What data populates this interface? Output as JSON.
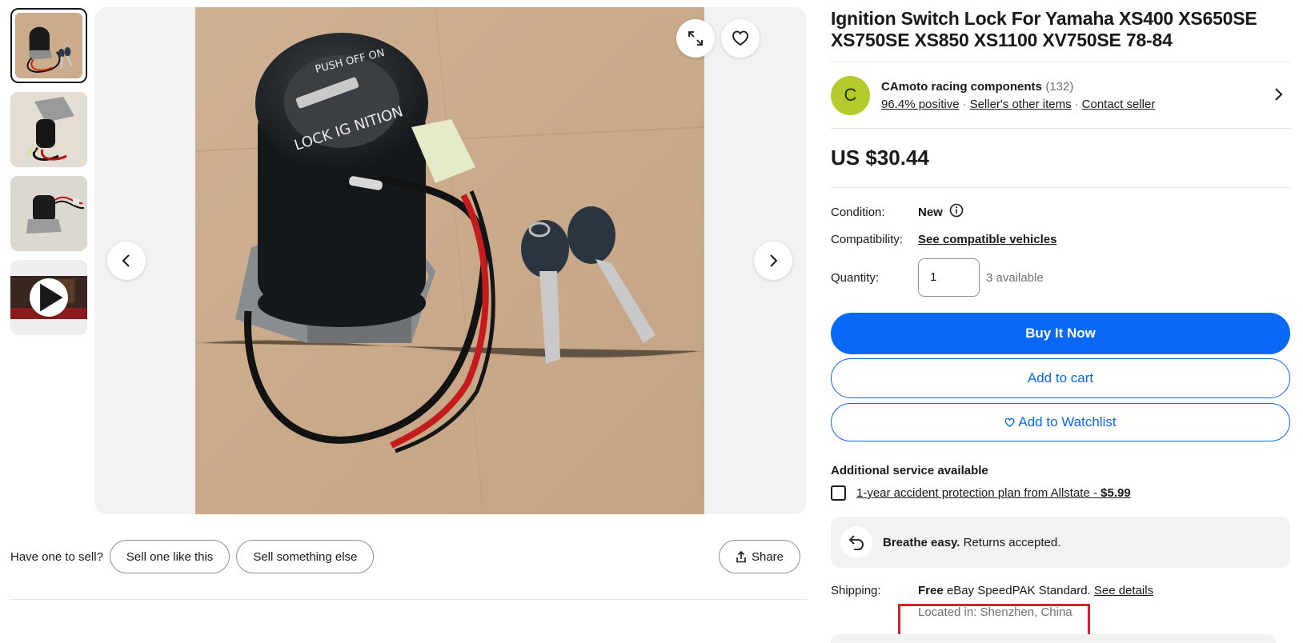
{
  "listing": {
    "title": "Ignition Switch Lock For Yamaha XS400 XS650SE XS750SE XS850 XS1100 XV750SE 78-84"
  },
  "seller": {
    "initial": "C",
    "name": "CAmoto racing components",
    "count": "(132)",
    "positive": "96.4% positive",
    "other_items": "Seller's other items",
    "contact": "Contact seller"
  },
  "price": "US $30.44",
  "condition": {
    "label": "Condition:",
    "value": "New"
  },
  "compatibility": {
    "label": "Compatibility:",
    "link": "See compatible vehicles"
  },
  "quantity": {
    "label": "Quantity:",
    "value": "1",
    "available": "3 available"
  },
  "buttons": {
    "buy_now": "Buy It Now",
    "add_to_cart": "Add to cart",
    "add_to_watchlist": "Add to Watchlist"
  },
  "additional_service": {
    "heading": "Additional service available",
    "plan_text": "1-year accident protection plan from Allstate - ",
    "plan_price": "$5.99"
  },
  "returns": {
    "bold": "Breathe easy.",
    "text": " Returns accepted."
  },
  "shipping": {
    "label": "Shipping:",
    "free": "Free",
    "method": " eBay SpeedPAK Standard. ",
    "details_link": "See details",
    "located": "Located in: Shenzhen, China"
  },
  "sell_row": {
    "label": "Have one to sell?",
    "sell_like": "Sell one like this",
    "sell_else": "Sell something else",
    "share": "Share"
  },
  "colors": {
    "primary": "#0968f6",
    "avatar": "#b6ca2d",
    "highlight": "#d0232a"
  },
  "icons": [
    "expand-icon",
    "heart-icon",
    "chevron-left-icon",
    "chevron-right-icon",
    "play-icon",
    "info-icon",
    "returns-icon",
    "share-icon"
  ]
}
